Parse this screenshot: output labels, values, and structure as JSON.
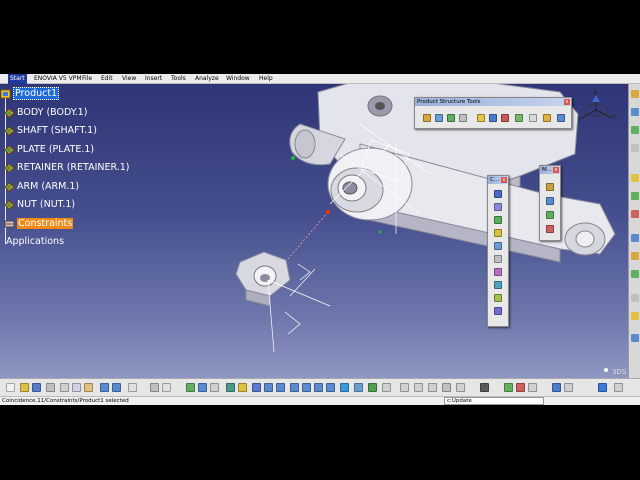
{
  "menu": {
    "start": "Start",
    "items": [
      "ENOVIA V5 VPM",
      "File",
      "Edit",
      "View",
      "Insert",
      "Tools",
      "Analyze",
      "Window",
      "Help"
    ]
  },
  "tree": {
    "root": "Product1",
    "children": [
      {
        "label": "BODY (BODY.1)"
      },
      {
        "label": "SHAFT (SHAFT.1)"
      },
      {
        "label": "PLATE (PLATE.1)"
      },
      {
        "label": "RETAINER (RETAINER.1)"
      },
      {
        "label": "ARM (ARM.1)"
      },
      {
        "label": "NUT (NUT.1)"
      }
    ],
    "constraints": "Constraints",
    "applications": "Applications"
  },
  "toolbars": {
    "product_structure": {
      "title": "Product Structure Tools",
      "close": "x"
    },
    "constraints": {
      "title": "C...",
      "close": "x"
    },
    "move": {
      "title": "M...",
      "close": "x"
    }
  },
  "status": {
    "message": "Coincidence.11/Constraints/Product1 selected",
    "command": "c:Update"
  },
  "colors": {
    "viewport_top": "#2f3576",
    "viewport_bottom": "#8e97c2",
    "selection": "#1e6ad8",
    "constraint_highlight": "#ee8a1a"
  }
}
